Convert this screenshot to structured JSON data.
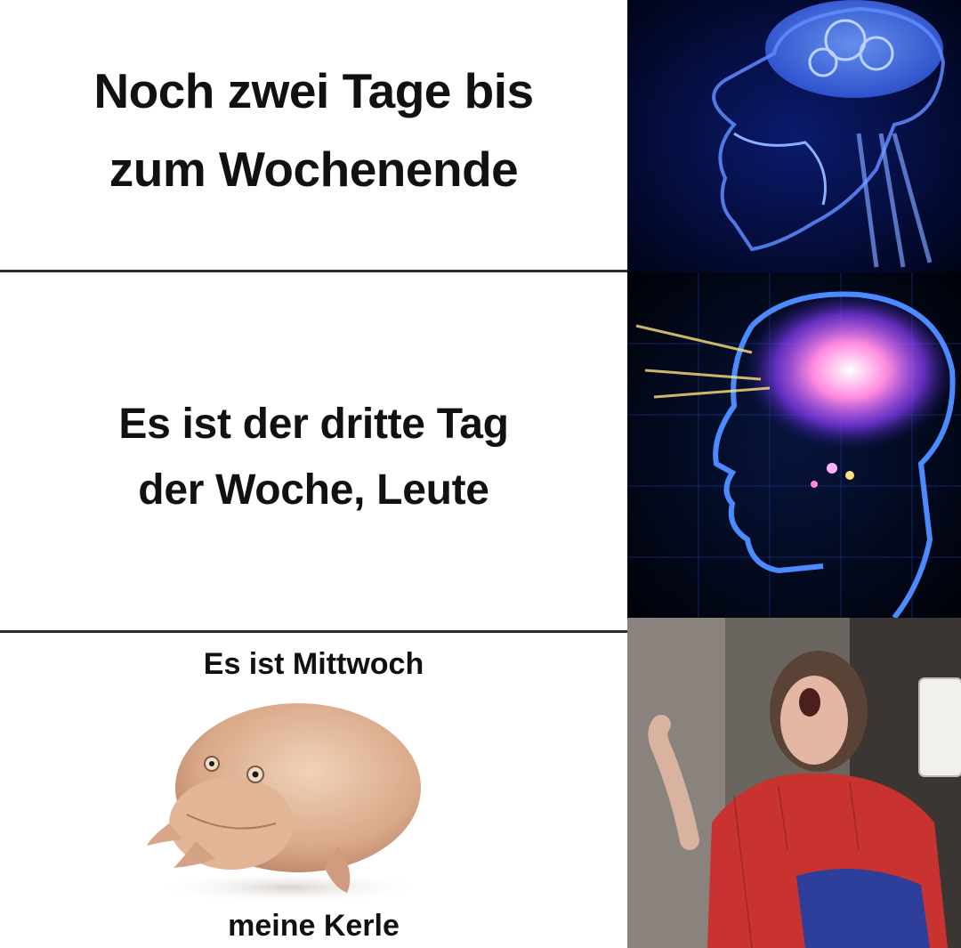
{
  "panels": [
    {
      "lines": [
        "Noch zwei Tage bis",
        "zum Wochenende"
      ],
      "image": "glowing-skull-brain"
    },
    {
      "lines": [
        "Es ist der dritte Tag",
        "der Woche, Leute"
      ],
      "image": "galaxy-brain-head"
    },
    {
      "top_text": "Es ist Mittwoch",
      "bottom_text": "meine Kerle",
      "image": "wednesday-frog",
      "reaction_image": "screaming-spider-man-costume"
    }
  ],
  "colors": {
    "text": "#111111",
    "divider": "#2b2b2b",
    "brain_blue": "#3a6dff",
    "glow_pink": "#ff6ad5",
    "costume_red": "#c8322f"
  }
}
